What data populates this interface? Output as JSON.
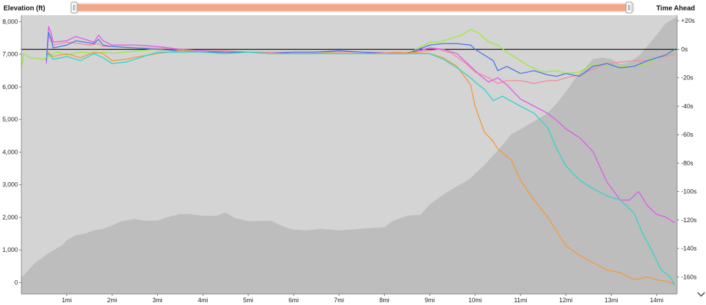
{
  "header": {
    "left_title": "Elevation (ft)",
    "right_title": "Time Ahead"
  },
  "scrubber": {
    "range_start": 0.0,
    "range_end": 1.0
  },
  "colors": {
    "plot_bg": "#d4d4d4",
    "elevation_fill": "#bdbdbd",
    "scrubber_fill": "#f3a789",
    "zero_line": "#111111"
  },
  "chart_data": {
    "type": "area",
    "xlim": [
      0,
      14.45
    ],
    "x_ticks": [
      "1mi",
      "2mi",
      "3mi",
      "4mi",
      "5mi",
      "6mi",
      "7mi",
      "8mi",
      "9mi",
      "10mi",
      "11mi",
      "12mi",
      "13mi",
      "14mi"
    ],
    "x_tick_values": [
      1,
      2,
      3,
      4,
      5,
      6,
      7,
      8,
      9,
      10,
      11,
      12,
      13,
      14
    ],
    "y_left": {
      "label": "Elevation (ft)",
      "ylim": [
        -350,
        8200
      ],
      "ticks": [
        "0",
        "1,000",
        "2,000",
        "3,000",
        "4,000",
        "5,000",
        "6,000",
        "7,000",
        "8,000"
      ],
      "tick_values": [
        0,
        1000,
        2000,
        3000,
        4000,
        5000,
        6000,
        7000,
        8000
      ]
    },
    "y_right": {
      "label": "Time Ahead",
      "ylim": [
        -172,
        24
      ],
      "ticks": [
        "+20s",
        "0s",
        "-20s",
        "-40s",
        "-60s",
        "-80s",
        "-100s",
        "-120s",
        "-140s",
        "-160s"
      ],
      "tick_values": [
        20,
        0,
        -20,
        -40,
        -60,
        -80,
        -100,
        -120,
        -140,
        -160
      ]
    },
    "elevation": {
      "x": [
        0,
        0.1,
        0.3,
        0.6,
        0.9,
        1.0,
        1.2,
        1.4,
        1.6,
        1.8,
        2.0,
        2.2,
        2.5,
        2.7,
        3.0,
        3.2,
        3.5,
        3.7,
        4.0,
        4.3,
        4.5,
        4.7,
        5.0,
        5.5,
        5.8,
        6.0,
        6.3,
        6.6,
        7.0,
        7.5,
        8.0,
        8.2,
        8.5,
        8.8,
        9.0,
        9.3,
        9.6,
        9.9,
        10.2,
        10.5,
        10.8,
        11.0,
        11.3,
        11.6,
        11.8,
        12.0,
        12.2,
        12.4,
        12.6,
        12.8,
        13.0,
        13.2,
        13.4,
        13.6,
        13.8,
        14.0,
        14.2,
        14.45
      ],
      "values": [
        150,
        300,
        600,
        900,
        1150,
        1300,
        1450,
        1500,
        1600,
        1650,
        1750,
        1880,
        1950,
        1900,
        1900,
        2000,
        2100,
        2100,
        2050,
        2050,
        2150,
        1980,
        1880,
        1900,
        1700,
        1620,
        1600,
        1650,
        1600,
        1650,
        1700,
        1900,
        2050,
        2080,
        2400,
        2700,
        2950,
        3200,
        3600,
        4050,
        4550,
        4700,
        4950,
        5200,
        5500,
        5850,
        6250,
        6550,
        6850,
        6900,
        6850,
        6700,
        6750,
        6950,
        7250,
        7600,
        7950,
        8150
      ]
    },
    "series": [
      {
        "name": "",
        "color": "#9bea3a",
        "x": [
          0,
          0.05,
          0.2,
          0.5,
          0.6,
          0.7,
          0.8,
          1.0,
          1.3,
          1.6,
          1.8,
          2.0,
          2.3,
          2.6,
          3.0,
          3.5,
          4.0,
          4.5,
          5.0,
          5.5,
          6.0,
          6.5,
          7.0,
          7.5,
          8.0,
          8.5,
          9.0,
          9.2,
          9.5,
          9.7,
          9.9,
          10.1,
          10.3,
          10.5,
          10.7,
          11.0,
          11.2,
          11.5,
          11.8,
          12.0,
          12.3,
          12.6,
          12.9,
          13.2,
          13.5,
          13.8,
          14.0,
          14.2,
          14.4
        ],
        "values": [
          -13,
          -3,
          -6,
          -7,
          -5,
          -3,
          -2,
          -4,
          -2,
          -3,
          -2,
          -3,
          -2,
          -1,
          0,
          -1,
          -1,
          -2,
          -2,
          -3,
          -3,
          -3,
          -2,
          -2,
          -3,
          -3,
          5,
          5,
          8,
          10,
          14,
          11,
          5,
          3,
          -2,
          -8,
          -12,
          -16,
          -15,
          -17,
          -16,
          -10,
          -11,
          -12,
          -12,
          -10,
          -6,
          -4,
          -1
        ]
      },
      {
        "name": "",
        "color": "#f28ba0",
        "x": [
          0.55,
          0.6,
          0.65,
          0.7,
          1.0,
          1.3,
          1.5,
          1.7,
          1.8,
          2.0,
          2.5,
          3.0,
          3.5,
          4.0,
          4.5,
          5.0,
          5.5,
          6.0,
          6.5,
          7.0,
          7.5,
          8.0,
          8.5,
          9.0,
          9.2,
          9.5,
          9.8,
          10.0,
          10.3,
          10.5,
          10.7,
          11.0,
          11.3,
          11.6,
          11.8,
          12.0,
          12.3,
          12.6,
          12.9,
          13.2,
          13.5,
          13.8,
          14.0,
          14.2,
          14.4
        ],
        "values": [
          -8,
          10,
          6,
          3,
          5,
          4,
          3,
          4,
          2,
          2,
          1,
          1,
          0,
          -1,
          -1,
          -2,
          -2,
          -2,
          -2,
          -2,
          -2,
          -2,
          -2,
          -1,
          0,
          -3,
          -10,
          -16,
          -20,
          -24,
          -22,
          -22,
          -24,
          -22,
          -22,
          -20,
          -18,
          -14,
          -10,
          -9,
          -8,
          -8,
          -6,
          -5,
          -3
        ]
      },
      {
        "name": "",
        "color": "#e05ae8",
        "x": [
          0.55,
          0.6,
          0.65,
          0.7,
          1.0,
          1.2,
          1.4,
          1.6,
          1.7,
          1.8,
          2.0,
          2.5,
          3.0,
          3.5,
          4.0,
          4.5,
          5.0,
          5.5,
          6.0,
          6.5,
          7.0,
          7.5,
          8.0,
          8.5,
          9.0,
          9.3,
          9.6,
          9.9,
          10.1,
          10.3,
          10.5,
          10.7,
          11.0,
          11.3,
          11.6,
          11.8,
          12.0,
          12.3,
          12.6,
          12.9,
          13.2,
          13.4,
          13.6,
          13.8,
          14.0,
          14.2,
          14.4
        ],
        "values": [
          -10,
          16,
          12,
          5,
          6,
          9,
          7,
          5,
          10,
          6,
          3,
          3,
          2,
          0,
          -1,
          -2,
          -2,
          -3,
          -2,
          -2,
          -1,
          -2,
          -3,
          -3,
          1,
          0,
          -3,
          -12,
          -18,
          -23,
          -20,
          -25,
          -35,
          -40,
          -45,
          -50,
          -56,
          -62,
          -72,
          -93,
          -106,
          -106,
          -100,
          -110,
          -116,
          -118,
          -122
        ]
      },
      {
        "name": "",
        "color": "#4a78e8",
        "x": [
          0.55,
          0.6,
          0.65,
          0.7,
          1.0,
          1.2,
          1.4,
          1.6,
          1.7,
          1.8,
          2.0,
          2.5,
          3.0,
          3.5,
          4.0,
          4.5,
          5.0,
          5.5,
          6.0,
          6.5,
          7.0,
          7.5,
          8.0,
          8.5,
          9.0,
          9.3,
          9.6,
          9.9,
          10.0,
          10.2,
          10.4,
          10.5,
          10.7,
          11.0,
          11.3,
          11.6,
          11.8,
          12.0,
          12.3,
          12.6,
          12.9,
          13.2,
          13.5,
          13.8,
          14.0,
          14.2,
          14.4
        ],
        "values": [
          -8,
          12,
          8,
          1,
          3,
          6,
          5,
          4,
          7,
          3,
          2,
          1,
          0,
          -1,
          -2,
          -2,
          -2,
          -3,
          -2,
          -2,
          -1,
          -2,
          -3,
          -3,
          3,
          4,
          4,
          3,
          0,
          -4,
          -8,
          -15,
          -12,
          -17,
          -15,
          -18,
          -19,
          -17,
          -19,
          -12,
          -10,
          -13,
          -12,
          -8,
          -6,
          -4,
          0
        ]
      },
      {
        "name": "",
        "color": "#f59a3a",
        "x": [
          0.55,
          0.6,
          0.65,
          0.7,
          1.0,
          1.3,
          1.6,
          1.8,
          2.0,
          2.3,
          2.6,
          3.0,
          3.5,
          4.0,
          4.5,
          5.0,
          5.5,
          6.0,
          6.5,
          7.0,
          7.5,
          8.0,
          8.5,
          9.0,
          9.3,
          9.6,
          9.9,
          10.0,
          10.2,
          10.4,
          10.5,
          10.8,
          11.0,
          11.3,
          11.6,
          11.8,
          12.0,
          12.3,
          12.6,
          12.9,
          13.2,
          13.5,
          13.8,
          14.0,
          14.2,
          14.4
        ],
        "values": [
          -6,
          -2,
          -4,
          -5,
          -3,
          -6,
          -2,
          -3,
          -8,
          -7,
          -5,
          -3,
          -1,
          -2,
          -3,
          -2,
          -3,
          -3,
          -3,
          -3,
          -3,
          -3,
          -2,
          -3,
          -6,
          -12,
          -25,
          -40,
          -58,
          -65,
          -70,
          -78,
          -92,
          -106,
          -118,
          -128,
          -138,
          -145,
          -150,
          -155,
          -157,
          -162,
          -160,
          -162,
          -163,
          -165
        ]
      },
      {
        "name": "",
        "color": "#2fd6c8",
        "x": [
          0.55,
          0.6,
          0.65,
          0.7,
          1.0,
          1.3,
          1.6,
          1.8,
          2.0,
          2.3,
          2.6,
          3.0,
          3.5,
          4.0,
          4.5,
          5.0,
          5.5,
          6.0,
          6.5,
          7.0,
          7.5,
          8.0,
          8.5,
          9.0,
          9.3,
          9.6,
          9.9,
          10.0,
          10.2,
          10.4,
          10.6,
          11.0,
          11.3,
          11.6,
          11.8,
          12.0,
          12.3,
          12.6,
          12.9,
          13.2,
          13.5,
          13.7,
          13.9,
          14.1,
          14.3,
          14.4
        ],
        "values": [
          -6,
          -3,
          -5,
          -7,
          -5,
          -8,
          -3,
          -6,
          -10,
          -9,
          -6,
          -2,
          -2,
          -2,
          -3,
          -2,
          -3,
          -3,
          -3,
          -3,
          -3,
          -3,
          -3,
          -3,
          -7,
          -13,
          -20,
          -23,
          -28,
          -36,
          -33,
          -40,
          -45,
          -55,
          -70,
          -82,
          -92,
          -98,
          -103,
          -106,
          -115,
          -130,
          -142,
          -155,
          -160,
          -166
        ]
      }
    ]
  }
}
